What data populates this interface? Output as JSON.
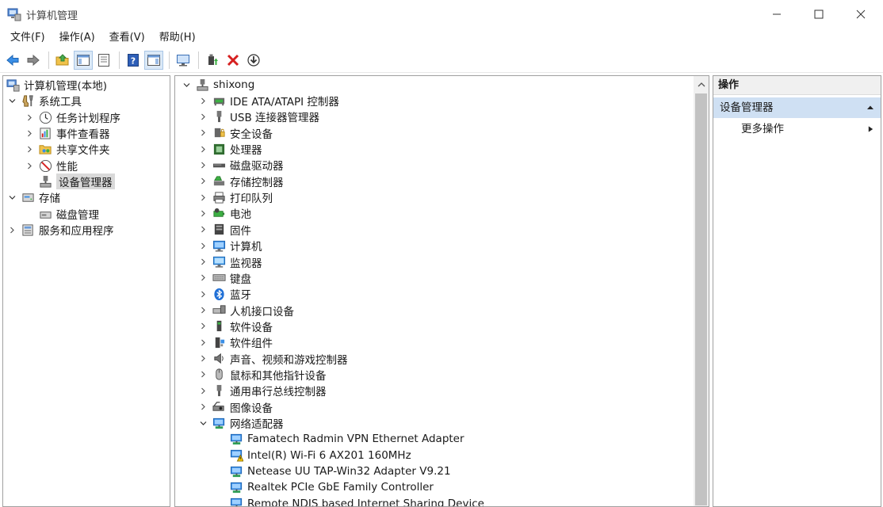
{
  "window": {
    "title": "计算机管理"
  },
  "menu": [
    "文件(F)",
    "操作(A)",
    "查看(V)",
    "帮助(H)"
  ],
  "toolbar": {
    "buttons": [
      "back-icon",
      "forward-icon",
      "up-folder-icon",
      "show-hide-tree-icon",
      "properties-icon",
      "help-icon",
      "show-hide-action-icon",
      "monitor-icon",
      "update-driver-icon",
      "uninstall-icon",
      "scan-icon"
    ],
    "pressed": [
      "show-hide-tree-icon",
      "show-hide-action-icon"
    ]
  },
  "left_tree": [
    {
      "label": "计算机管理(本地)",
      "level": 0,
      "chevron": "none",
      "icon": "computer-management-icon"
    },
    {
      "label": "系统工具",
      "level": 1,
      "chevron": "down",
      "icon": "system-tools-icon"
    },
    {
      "label": "任务计划程序",
      "level": 2,
      "chevron": "right",
      "icon": "task-scheduler-icon"
    },
    {
      "label": "事件查看器",
      "level": 2,
      "chevron": "right",
      "icon": "event-viewer-icon"
    },
    {
      "label": "共享文件夹",
      "level": 2,
      "chevron": "right",
      "icon": "shared-folders-icon"
    },
    {
      "label": "性能",
      "level": 2,
      "chevron": "right",
      "icon": "performance-icon"
    },
    {
      "label": "设备管理器",
      "level": 2,
      "chevron": "none",
      "icon": "device-manager-icon",
      "selected": true
    },
    {
      "label": "存储",
      "level": 1,
      "chevron": "down",
      "icon": "storage-icon"
    },
    {
      "label": "磁盘管理",
      "level": 2,
      "chevron": "none",
      "icon": "disk-management-icon"
    },
    {
      "label": "服务和应用程序",
      "level": 1,
      "chevron": "right",
      "icon": "services-apps-icon"
    }
  ],
  "device_tree": {
    "root": "shixong",
    "categories": [
      {
        "label": "IDE ATA/ATAPI 控制器",
        "icon": "ide-controller-icon"
      },
      {
        "label": "USB 连接器管理器",
        "icon": "usb-connector-icon"
      },
      {
        "label": "安全设备",
        "icon": "security-device-icon"
      },
      {
        "label": "处理器",
        "icon": "processor-icon"
      },
      {
        "label": "磁盘驱动器",
        "icon": "disk-drive-icon"
      },
      {
        "label": "存储控制器",
        "icon": "storage-controller-icon"
      },
      {
        "label": "打印队列",
        "icon": "printer-icon"
      },
      {
        "label": "电池",
        "icon": "battery-icon"
      },
      {
        "label": "固件",
        "icon": "firmware-icon"
      },
      {
        "label": "计算机",
        "icon": "computer-icon"
      },
      {
        "label": "监视器",
        "icon": "monitor-icon"
      },
      {
        "label": "键盘",
        "icon": "keyboard-icon"
      },
      {
        "label": "蓝牙",
        "icon": "bluetooth-icon"
      },
      {
        "label": "人机接口设备",
        "icon": "hid-icon"
      },
      {
        "label": "软件设备",
        "icon": "software-device-icon"
      },
      {
        "label": "软件组件",
        "icon": "software-component-icon"
      },
      {
        "label": "声音、视频和游戏控制器",
        "icon": "speaker-icon"
      },
      {
        "label": "鼠标和其他指针设备",
        "icon": "mouse-icon"
      },
      {
        "label": "通用串行总线控制器",
        "icon": "usb-controller-icon"
      },
      {
        "label": "图像设备",
        "icon": "camera-icon"
      },
      {
        "label": "网络适配器",
        "icon": "network-adapter-icon",
        "expanded": true
      }
    ],
    "network_adapters": [
      {
        "label": "Famatech Radmin VPN Ethernet Adapter",
        "icon": "network-adapter-icon"
      },
      {
        "label": "Intel(R) Wi-Fi 6 AX201 160MHz",
        "icon": "network-adapter-warning-icon"
      },
      {
        "label": "Netease UU TAP-Win32 Adapter V9.21",
        "icon": "network-adapter-icon"
      },
      {
        "label": "Realtek PCIe GbE Family Controller",
        "icon": "network-adapter-icon"
      },
      {
        "label": "Remote NDIS based Internet Sharing Device",
        "icon": "network-adapter-icon"
      }
    ]
  },
  "actions": {
    "header": "操作",
    "section": "设备管理器",
    "more": "更多操作"
  },
  "colors": {
    "selection": "#d9d9d9",
    "action_section": "#cfe0f3",
    "accent_blue": "#2f7fd3",
    "toolbar_pressed": "#dbe9f7"
  }
}
